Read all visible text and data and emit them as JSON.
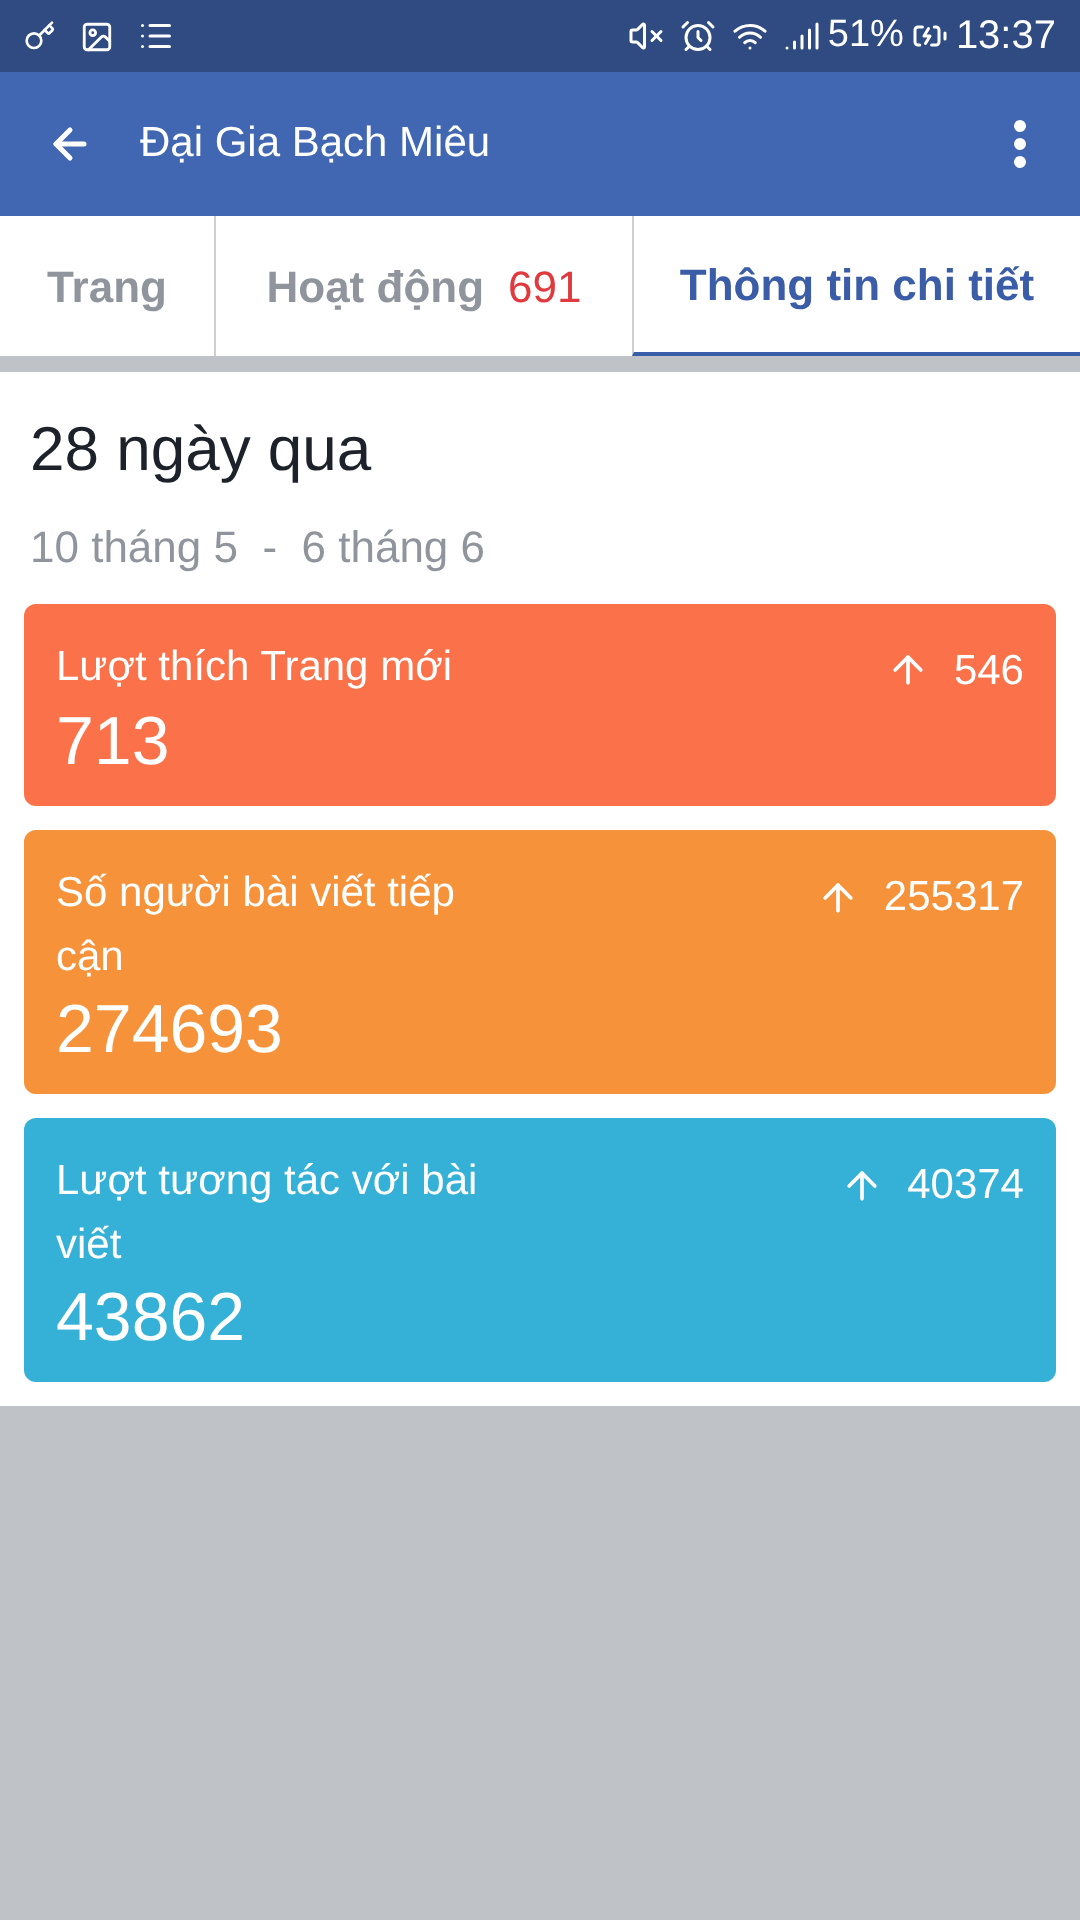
{
  "status_bar": {
    "battery": "51%",
    "time": "13:37"
  },
  "app_bar": {
    "title": "Đại Gia Bạch Miêu"
  },
  "tabs": [
    {
      "label": "Trang",
      "selected": false
    },
    {
      "label": "Hoạt động",
      "count": "691",
      "selected": false
    },
    {
      "label": "Thông tin chi tiết",
      "selected": true
    }
  ],
  "period": {
    "title": "28 ngày qua",
    "range": "10 tháng 5  -  6 tháng 6"
  },
  "cards": [
    {
      "label": "Lượt thích Trang mới",
      "change": "546",
      "value": "713",
      "color": "#fb7149"
    },
    {
      "label": "Số người bài viết tiếp cận",
      "change": "255317",
      "value": "274693",
      "color": "#f5923a"
    },
    {
      "label": "Lượt tương tác với bài viết",
      "change": "40374",
      "value": "43862",
      "color": "#35b0d6"
    }
  ]
}
